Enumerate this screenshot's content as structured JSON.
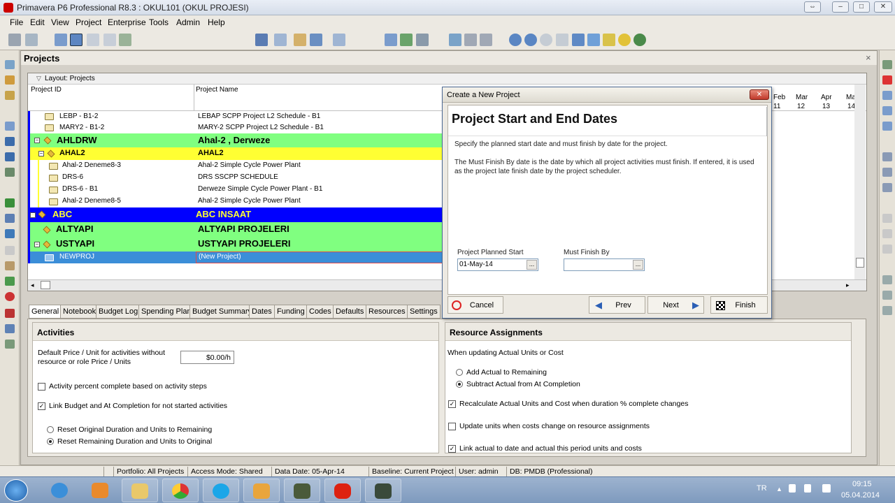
{
  "window": {
    "title": "Primavera P6 Professional R8.3 : OKUL101 (OKUL PROJESI)"
  },
  "menu": [
    "File",
    "Edit",
    "View",
    "Project",
    "Enterprise",
    "Tools",
    "Admin",
    "Help"
  ],
  "panel": {
    "title": "Projects",
    "layout_label": "Layout: Projects"
  },
  "columns": {
    "id": "Project ID",
    "name": "Project Name"
  },
  "gantt": {
    "months": [
      "Feb",
      "Mar",
      "Apr",
      "Ma"
    ],
    "weeks": [
      "11",
      "12",
      "13",
      "14"
    ]
  },
  "rows": [
    {
      "id": "LEBP - B1-2",
      "name": "LEBAP SCPP Project L2 Schedule - B1"
    },
    {
      "id": "MARY2 - B1-2",
      "name": "MARY-2 SCPP Project L2 Schedule - B1"
    },
    {
      "id": "AHLDRW",
      "name": "Ahal-2 ,  Derweze"
    },
    {
      "id": "AHAL2",
      "name": "AHAL2"
    },
    {
      "id": "Ahal-2 Deneme8-3",
      "name": "Ahal-2 Simple Cycle Power Plant"
    },
    {
      "id": "DRS-6",
      "name": "DRS SSCPP SCHEDULE"
    },
    {
      "id": "DRS-6 - B1",
      "name": "Derweze Simple Cycle Power Plant - B1"
    },
    {
      "id": "Ahal-2 Deneme8-5",
      "name": "Ahal-2 Simple Cycle Power Plant"
    },
    {
      "id": "ABC",
      "name": "ABC INSAAT"
    },
    {
      "id": "ALTYAPI",
      "name": "ALTYAPI PROJELERI"
    },
    {
      "id": "USTYAPI",
      "name": "USTYAPI PROJELERI"
    },
    {
      "id": "NEWPROJ",
      "name": "(New Project)"
    }
  ],
  "tabs": [
    "General",
    "Notebook",
    "Budget Log",
    "Spending Plan",
    "Budget Summary",
    "Dates",
    "Funding",
    "Codes",
    "Defaults",
    "Resources",
    "Settings"
  ],
  "activities": {
    "title": "Activities",
    "price_label_1": "Default Price / Unit for activities without",
    "price_label_2": "resource or role Price / Units",
    "price_value": "$0.00/h",
    "cb_percent": "Activity percent complete based on activity steps",
    "cb_link": "Link Budget and At Completion for not started activities",
    "rb_reset_original": "Reset Original Duration and Units to Remaining",
    "rb_reset_remaining": "Reset Remaining Duration and Units to Original"
  },
  "resource_assignments": {
    "title": "Resource Assignments",
    "when": "When updating Actual Units or Cost",
    "rb_add": "Add Actual to Remaining",
    "rb_subtract": "Subtract Actual from At Completion",
    "cb_recalc": "Recalculate Actual Units and Cost when duration % complete changes",
    "cb_update": "Update units when costs change on resource assignments",
    "cb_link": "Link actual to date and actual this period units and costs"
  },
  "dialog": {
    "title": "Create a New Project",
    "heading": "Project Start and End Dates",
    "p1": "Specify the planned start date and must finish by date for the project.",
    "p2a": "The Must Finish By date is the date by which all project activities must finish.  If entered, it is used",
    "p2b": "as the project late finish date by the project scheduler.",
    "start_label": "Project Planned Start",
    "start_value": "01-May-14",
    "finish_label": "Must Finish By",
    "finish_value": "",
    "ellipsis": "...",
    "cancel": "Cancel",
    "prev": "Prev",
    "next": "Next",
    "finish": "Finish"
  },
  "status": {
    "portfolio": "Portfolio: All Projects",
    "access": "Access Mode: Shared",
    "data_date": "Data Date: 05-Apr-14",
    "baseline": "Baseline: Current Project",
    "user": "User: admin",
    "db": "DB: PMDB (Professional)"
  },
  "taskbar": {
    "lang": "TR",
    "time": "09:15",
    "date": "05.04.2014"
  },
  "colors": {
    "green_row": "#80ff80",
    "yellow_row": "#ffff33",
    "blue_row": "#0000ff",
    "selected_row": "#3b8ed8"
  }
}
